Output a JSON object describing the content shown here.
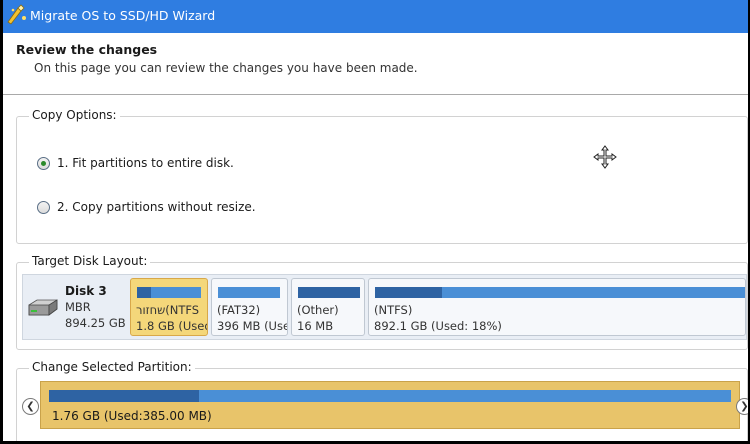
{
  "window": {
    "title": "Migrate OS to SSD/HD Wizard"
  },
  "header": {
    "title": "Review the changes",
    "subtitle": "On this page you can review the changes you have been made."
  },
  "copy_options": {
    "label": "Copy Options:",
    "options": [
      {
        "label": "1. Fit partitions to entire disk.",
        "checked": true
      },
      {
        "label": "2. Copy partitions without resize.",
        "checked": false
      }
    ]
  },
  "target_disk": {
    "label": "Target Disk Layout:",
    "disk": {
      "name": "Disk 3",
      "type": "MBR",
      "size": "894.25 GB"
    },
    "partitions": [
      {
        "name": "שחזור(NTFS",
        "info": "1.8 GB (Used:",
        "used_fraction": 0.22,
        "selected": true
      },
      {
        "name": "(FAT32)",
        "info": "396 MB (Use",
        "used_fraction": 0.0,
        "selected": false
      },
      {
        "name": "(Other)",
        "info": "16 MB",
        "used_fraction": 1.0,
        "selected": false
      },
      {
        "name": "(NTFS)",
        "info": "892.1 GB (Used: 18%)",
        "used_fraction": 0.18,
        "selected": false
      }
    ]
  },
  "change_partition": {
    "label": "Change Selected Partition:",
    "info": "1.76 GB (Used:385.00 MB)",
    "used_fraction": 0.22
  },
  "colors": {
    "titlebar": "#2f7de1",
    "selected_partition": "#f4d77a",
    "bar_free": "#4a8fd6",
    "bar_used": "#2e63a3"
  }
}
